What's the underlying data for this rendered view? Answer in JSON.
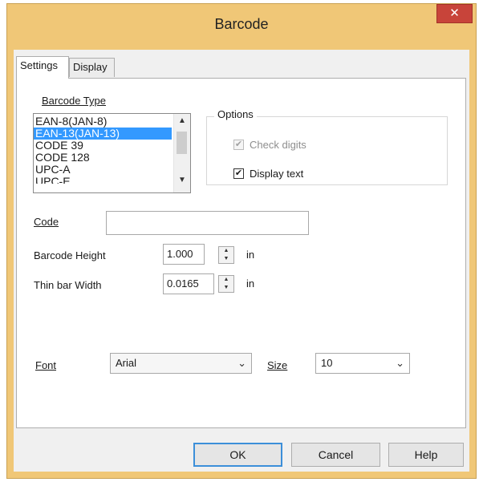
{
  "window": {
    "title": "Barcode",
    "close_symbol": "✕"
  },
  "tabs": [
    {
      "label": "Settings",
      "active": true
    },
    {
      "label": "Display",
      "active": false
    }
  ],
  "barcode_type": {
    "label": "Barcode Type",
    "items": [
      "EAN-8(JAN-8)",
      "EAN-13(JAN-13)",
      "CODE 39",
      "CODE 128",
      "UPC-A",
      "UPC-E"
    ],
    "selected": "EAN-13(JAN-13)"
  },
  "options": {
    "legend": "Options",
    "check_digits": {
      "label": "Check digits",
      "checked": true,
      "enabled": false
    },
    "display_text": {
      "label": "Display text",
      "checked": true,
      "enabled": true
    }
  },
  "code": {
    "label": "Code",
    "value": ""
  },
  "barcode_height": {
    "label": "Barcode Height",
    "value": "1.000",
    "unit": "in"
  },
  "thin_bar_width": {
    "label": "Thin bar Width",
    "value": "0.0165",
    "unit": "in"
  },
  "font": {
    "label": "Font",
    "value": "Arial"
  },
  "size": {
    "label": "Size",
    "value": "10"
  },
  "buttons": {
    "ok": "OK",
    "cancel": "Cancel",
    "help": "Help"
  },
  "glyphs": {
    "check": "✔",
    "chevron_down": "⌄",
    "scroll_up": "▲",
    "scroll_down": "▼",
    "spin_up": "▲",
    "spin_down": "▼"
  },
  "colors": {
    "frame": "#f0c777",
    "close": "#c8443a",
    "selection": "#3399ff",
    "default_button_border": "#3c8fd9"
  }
}
